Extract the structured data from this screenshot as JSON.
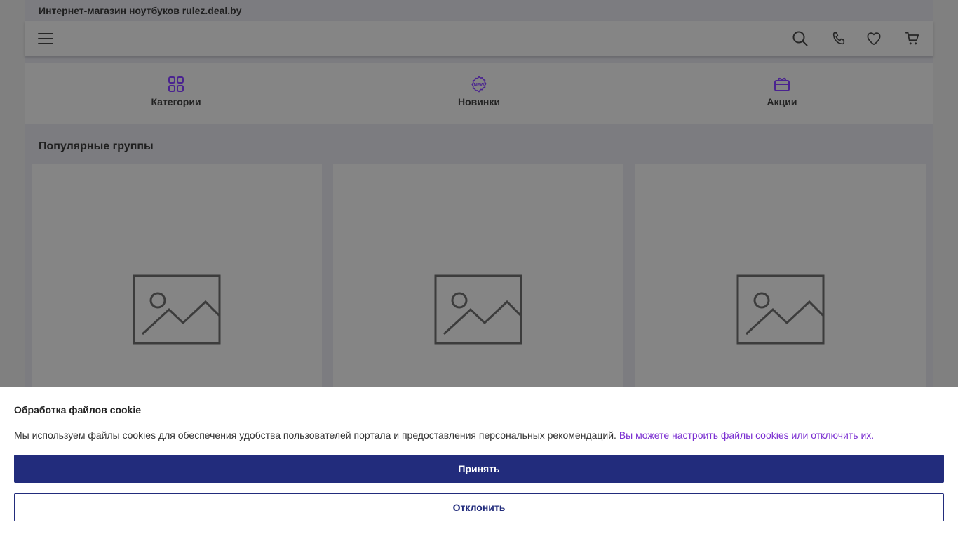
{
  "header": {
    "store_title": "Интернет-магазин ноутбуков rulez.deal.by",
    "icons": [
      "menu-icon",
      "search-icon",
      "phone-icon",
      "heart-icon",
      "cart-icon"
    ]
  },
  "quick_nav": [
    {
      "label": "Категории",
      "icon": "grid-icon"
    },
    {
      "label": "Новинки",
      "icon": "new-badge-icon",
      "badge_text": "NEW"
    },
    {
      "label": "Акции",
      "icon": "gift-icon"
    }
  ],
  "popular": {
    "title": "Популярные группы",
    "cards": [
      {
        "image": "image-placeholder-icon"
      },
      {
        "image": "image-placeholder-icon"
      },
      {
        "image": "image-placeholder-icon"
      }
    ]
  },
  "cookie_banner": {
    "title": "Обработка файлов cookie",
    "text": "Мы используем файлы cookies для обеспечения удобства пользователей портала и предоставления персональных рекомендаций.",
    "link_text": "Вы можете настроить файлы cookies или отключить их.",
    "accept_label": "Принять",
    "decline_label": "Отклонить"
  },
  "colors": {
    "accent": "#5b2aa0",
    "link": "#7b2fd1",
    "primary_button": "#222c7c",
    "overlay_gray": "#808080"
  }
}
